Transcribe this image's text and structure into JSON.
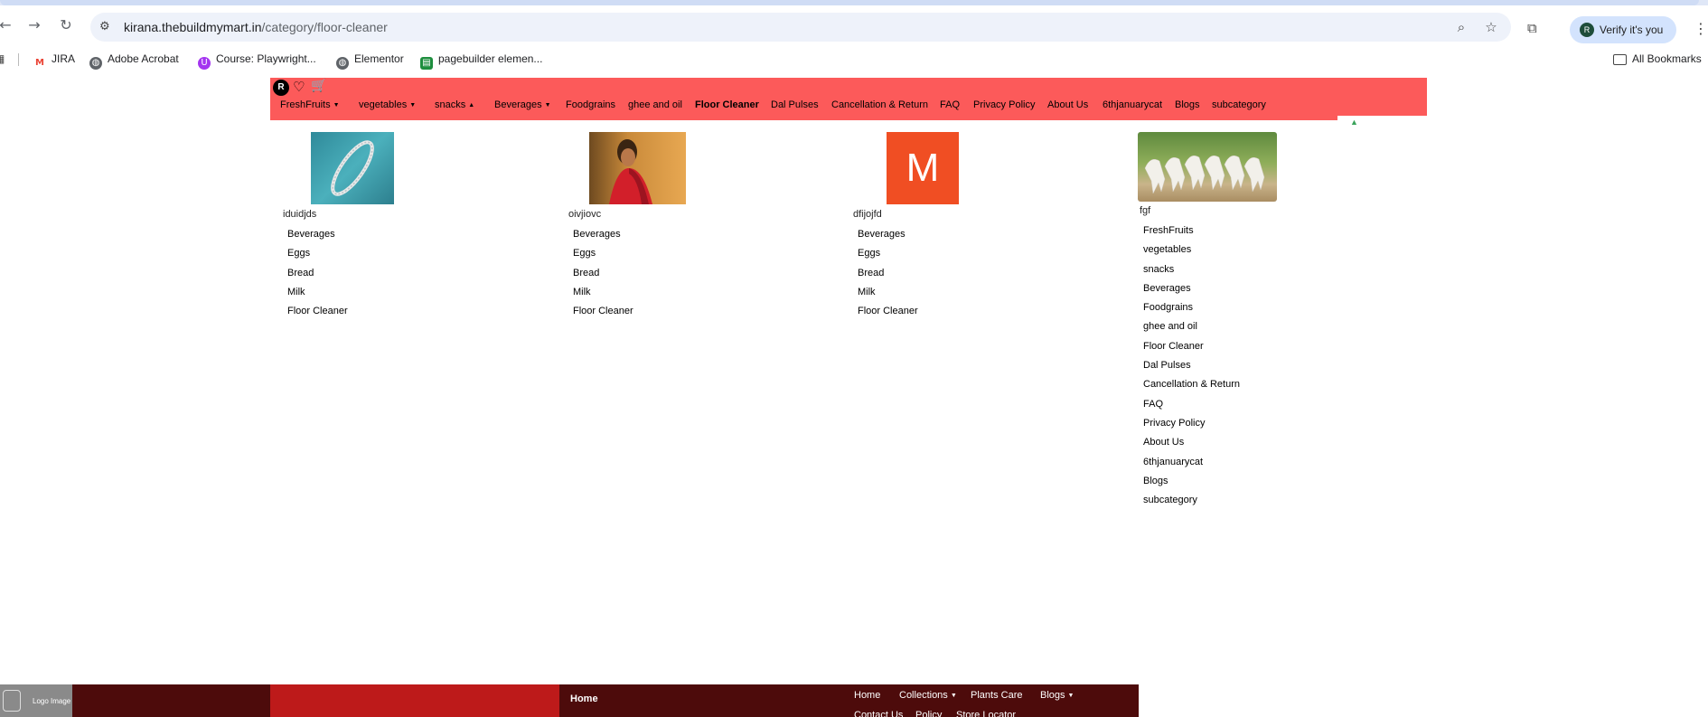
{
  "browser": {
    "url_host": "kirana.thebuildmymart.in",
    "url_path": "/category/floor-cleaner",
    "profile_initial": "R",
    "verify_label": "Verify it's you",
    "bookmarks": [
      {
        "label": "JIRA",
        "icon": "gmail-icon",
        "color": "#ea4335"
      },
      {
        "label": "Adobe Acrobat",
        "icon": "globe-icon",
        "color": "#5f6368"
      },
      {
        "label": "Course: Playwright...",
        "icon": "course-icon",
        "color": "#a435f0"
      },
      {
        "label": "Elementor",
        "icon": "globe-icon",
        "color": "#5f6368"
      },
      {
        "label": "pagebuilder elemen...",
        "icon": "sheets-icon",
        "color": "#1e8e3e"
      }
    ],
    "all_bookmarks_label": "All Bookmarks"
  },
  "header": {
    "avatar_initial": "R",
    "menu": [
      {
        "label": "FreshFruits",
        "caret": "▼"
      },
      {
        "label": "vegetables",
        "caret": "▼"
      },
      {
        "label": "snacks",
        "caret": "▲"
      },
      {
        "label": "Beverages",
        "caret": "▼"
      },
      {
        "label": "Foodgrains",
        "caret": ""
      },
      {
        "label": "ghee and oil",
        "caret": ""
      },
      {
        "label": "Floor Cleaner",
        "caret": ""
      },
      {
        "label": "Dal Pulses",
        "caret": ""
      },
      {
        "label": "Cancellation & Return",
        "caret": ""
      },
      {
        "label": "FAQ",
        "caret": ""
      },
      {
        "label": "Privacy Policy",
        "caret": ""
      },
      {
        "label": "About Us",
        "caret": ""
      },
      {
        "label": "6thjanuarycat",
        "caret": ""
      },
      {
        "label": "Blogs",
        "caret": ""
      },
      {
        "label": "subcategory",
        "caret": ""
      }
    ]
  },
  "cards": [
    {
      "name": "iduidjds",
      "items": [
        "Beverages",
        "Eggs",
        "Bread",
        "Milk",
        "Floor Cleaner"
      ]
    },
    {
      "name": "oivjiovc",
      "items": [
        "Beverages",
        "Eggs",
        "Bread",
        "Milk",
        "Floor Cleaner"
      ]
    },
    {
      "name": "dfijojfd",
      "logo_letter": "M",
      "items": [
        "Beverages",
        "Eggs",
        "Bread",
        "Milk",
        "Floor Cleaner"
      ]
    },
    {
      "name": "fgf",
      "items": [
        "FreshFruits",
        "vegetables",
        "snacks",
        "Beverages",
        "Foodgrains",
        "ghee and oil",
        "Floor Cleaner",
        "Dal Pulses",
        "Cancellation & Return",
        "FAQ",
        "Privacy Policy",
        "About Us",
        "6thjanuarycat",
        "Blogs",
        "subcategory"
      ]
    }
  ],
  "footer": {
    "logo_text": "Logo Image",
    "home": "Home",
    "nav": [
      {
        "label": "Home",
        "caret": ""
      },
      {
        "label": "Collections",
        "caret": "▼"
      },
      {
        "label": "Plants Care",
        "caret": ""
      },
      {
        "label": "Blogs",
        "caret": "▼"
      }
    ],
    "nav2": [
      "Contact Us",
      "Policy",
      "Store Locator"
    ]
  }
}
